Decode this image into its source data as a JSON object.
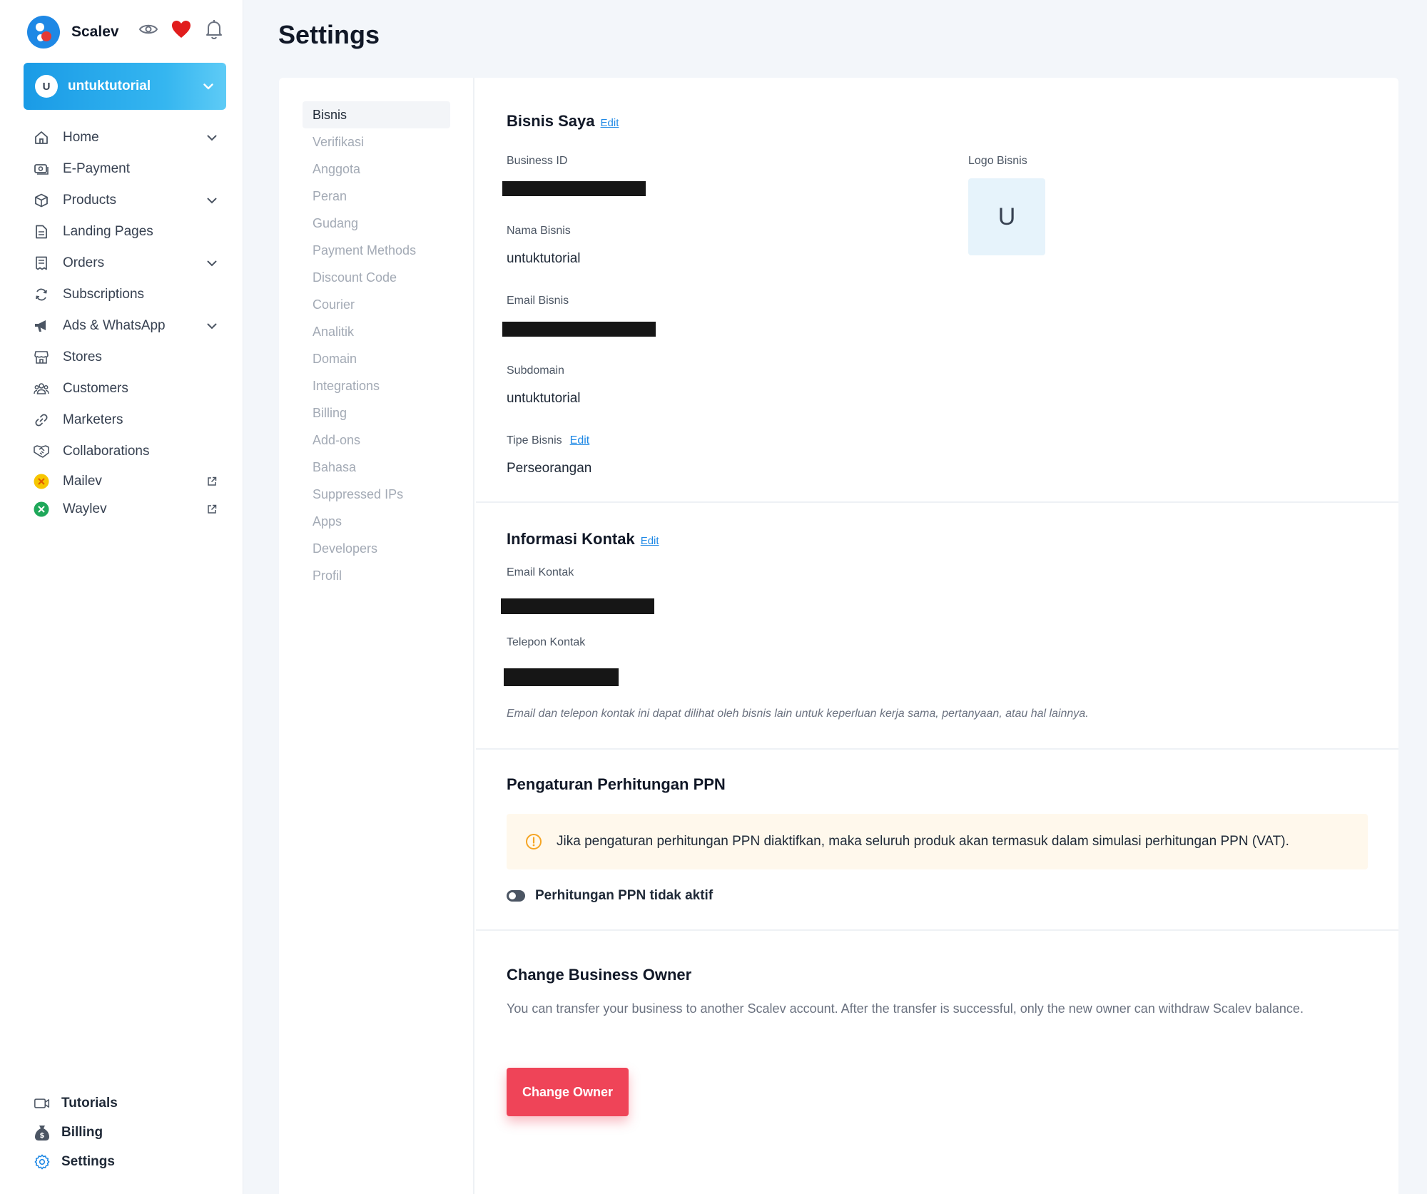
{
  "app": {
    "name": "Scalev",
    "business_switcher": {
      "initial": "U",
      "name": "untuktutorial"
    }
  },
  "sidebar": {
    "items": [
      {
        "label": "Home",
        "icon": "home-icon",
        "expandable": true
      },
      {
        "label": "E-Payment",
        "icon": "payment-icon",
        "expandable": false
      },
      {
        "label": "Products",
        "icon": "box-icon",
        "expandable": true
      },
      {
        "label": "Landing Pages",
        "icon": "document-icon",
        "expandable": false
      },
      {
        "label": "Orders",
        "icon": "receipt-icon",
        "expandable": true
      },
      {
        "label": "Subscriptions",
        "icon": "refresh-icon",
        "expandable": false
      },
      {
        "label": "Ads & WhatsApp",
        "icon": "megaphone-icon",
        "expandable": true
      },
      {
        "label": "Stores",
        "icon": "store-icon",
        "expandable": false
      },
      {
        "label": "Customers",
        "icon": "users-icon",
        "expandable": false
      },
      {
        "label": "Marketers",
        "icon": "link-icon",
        "expandable": false
      },
      {
        "label": "Collaborations",
        "icon": "handshake-icon",
        "expandable": false
      },
      {
        "label": "Mailev",
        "icon": "mailev-logo-icon",
        "external": true
      },
      {
        "label": "Waylev",
        "icon": "waylev-logo-icon",
        "external": true
      }
    ],
    "bottom_items": [
      {
        "label": "Tutorials",
        "icon": "video-icon"
      },
      {
        "label": "Billing",
        "icon": "money-bag-icon"
      },
      {
        "label": "Settings",
        "icon": "gear-icon"
      }
    ]
  },
  "page": {
    "title": "Settings"
  },
  "settings_nav": {
    "items": [
      "Bisnis",
      "Verifikasi",
      "Anggota",
      "Peran",
      "Gudang",
      "Payment Methods",
      "Discount Code",
      "Courier",
      "Analitik",
      "Domain",
      "Integrations",
      "Billing",
      "Add-ons",
      "Bahasa",
      "Suppressed IPs",
      "Apps",
      "Developers",
      "Profil"
    ],
    "active": "Bisnis"
  },
  "bisnis_saya": {
    "title": "Bisnis Saya",
    "edit": "Edit",
    "business_id_label": "Business ID",
    "nama_bisnis_label": "Nama Bisnis",
    "nama_bisnis_value": "untuktutorial",
    "email_bisnis_label": "Email Bisnis",
    "subdomain_label": "Subdomain",
    "subdomain_value": "untuktutorial",
    "tipe_bisnis_label": "Tipe Bisnis",
    "tipe_bisnis_edit": "Edit",
    "tipe_bisnis_value": "Perseorangan",
    "logo_label": "Logo Bisnis",
    "logo_initial": "U"
  },
  "informasi_kontak": {
    "title": "Informasi Kontak",
    "edit": "Edit",
    "email_label": "Email Kontak",
    "telepon_label": "Telepon Kontak",
    "note": "Email dan telepon kontak ini dapat dilihat oleh bisnis lain untuk keperluan kerja sama, pertanyaan, atau hal lainnya."
  },
  "ppn": {
    "title": "Pengaturan Perhitungan PPN",
    "alert": "Jika pengaturan perhitungan PPN diaktifkan, maka seluruh produk akan termasuk dalam simulasi perhitungan PPN (VAT).",
    "toggle_label": "Perhitungan PPN tidak aktif"
  },
  "owner": {
    "title": "Change Business Owner",
    "description": "You can transfer your business to another Scalev account. After the transfer is successful, only the new owner can withdraw Scalev balance.",
    "button": "Change Owner"
  },
  "colors": {
    "accent": "#1e88e5",
    "danger": "#ef4458",
    "alert_bg": "#fff8ec",
    "alert_icon": "#f5a524"
  }
}
